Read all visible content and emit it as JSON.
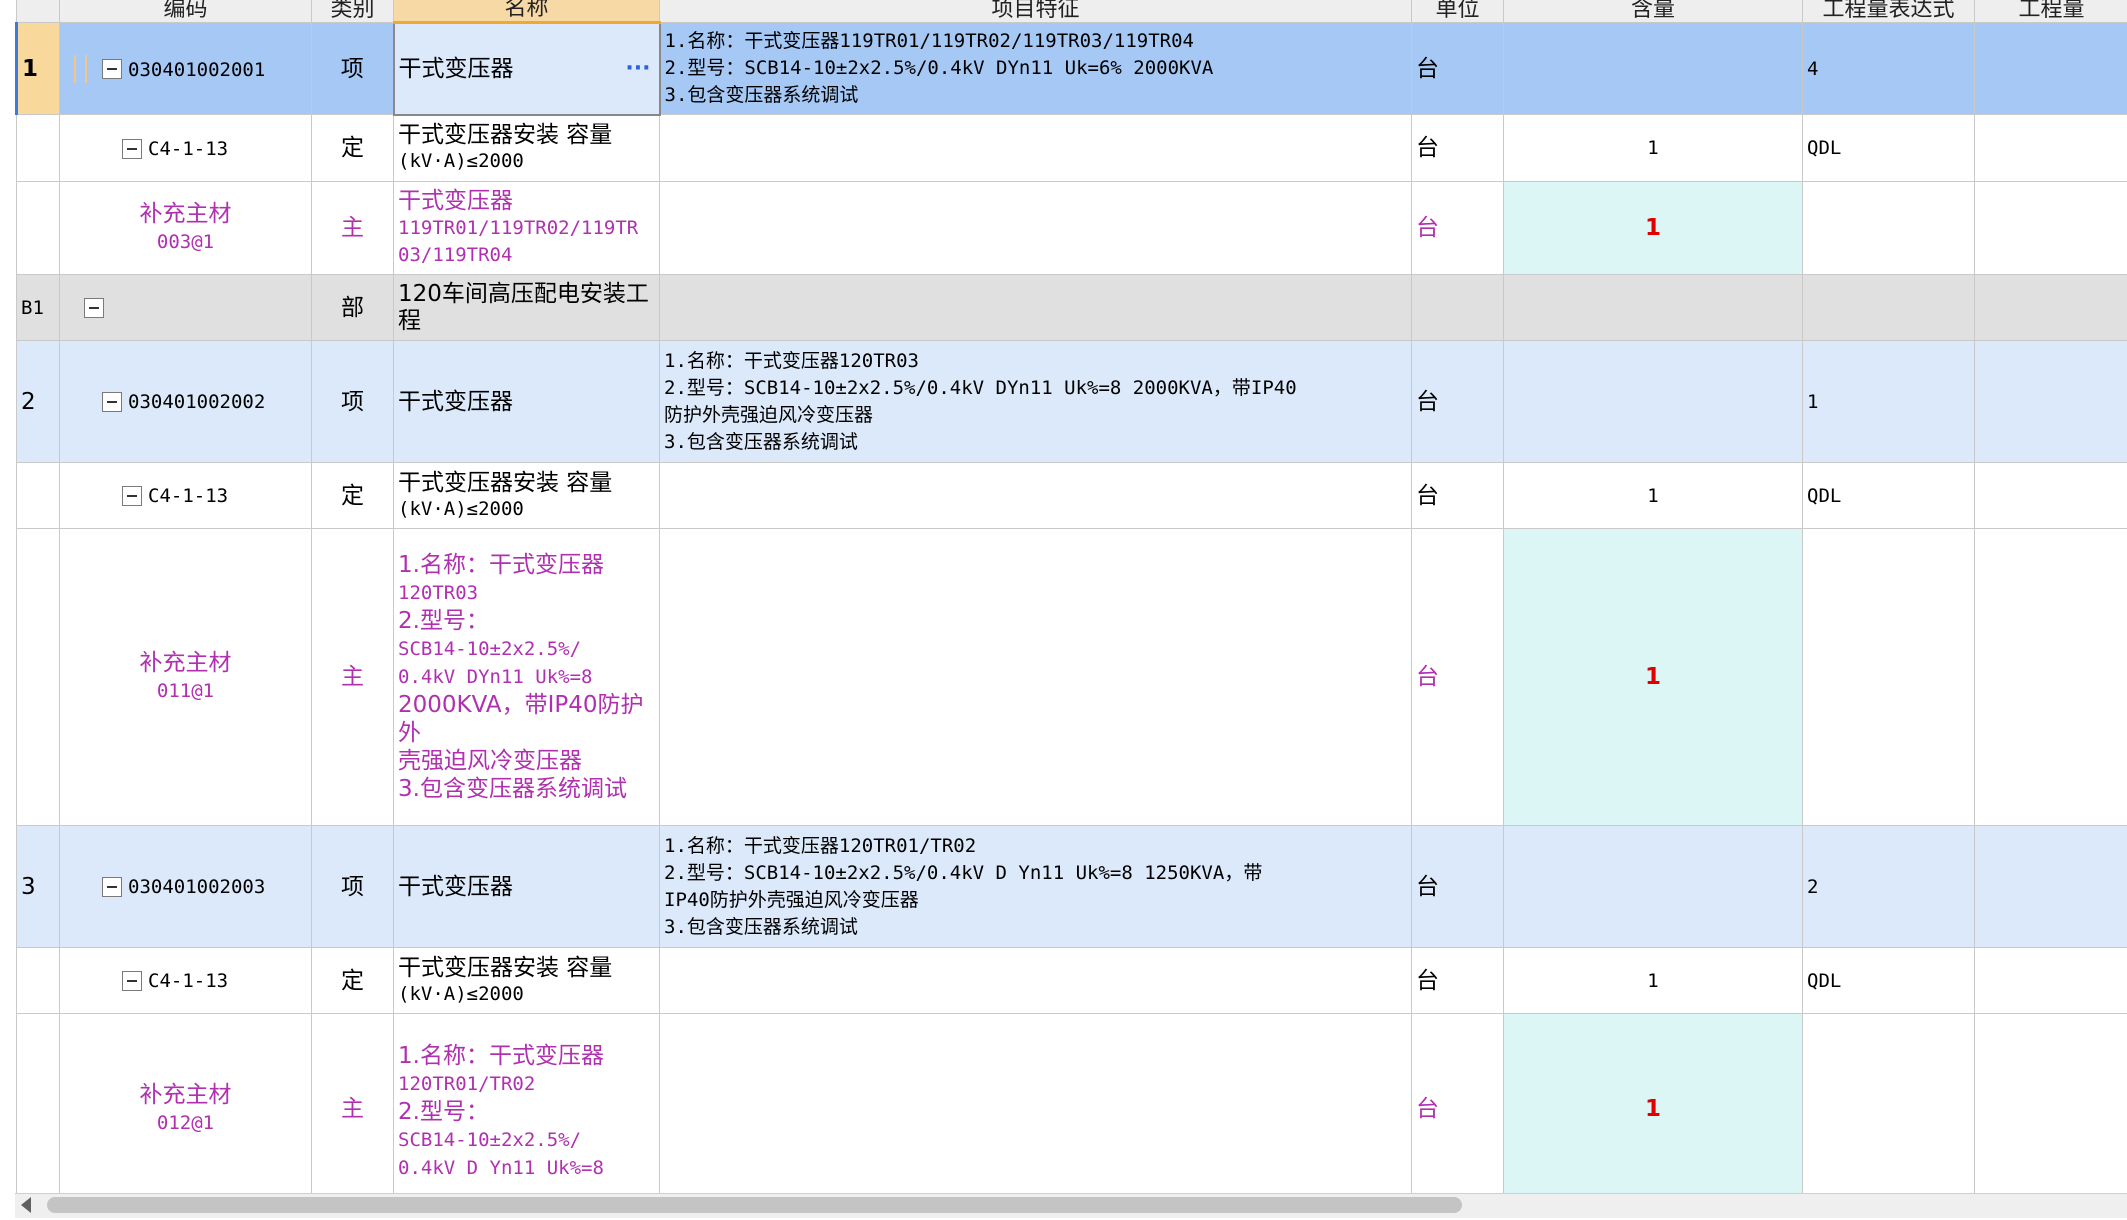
{
  "headers": [
    "编码",
    "类别",
    "名称",
    "项目特征",
    "单位",
    "含量",
    "工程量表达式",
    "工程量"
  ],
  "rows": [
    {
      "seq": "1",
      "code": "030401002001",
      "type": "项",
      "name": "干式变压器",
      "feat": [
        "1.名称：干式变压器119TR01/119TR02/119TR03/119TR04",
        "2.型号：SCB14-10±2x2.5%/0.4kV  DYn11  Uk=6%   2000KVA",
        "3.包含变压器系统调试"
      ],
      "unit": "台",
      "qty": "",
      "expr": "4",
      "amount": ""
    },
    {
      "seq": "",
      "code": "C4-1-13",
      "type": "定",
      "name": [
        "干式变压器安装 容量",
        "(kV·A)≤2000"
      ],
      "feat": [],
      "unit": "台",
      "qty": "1",
      "expr": "QDL",
      "amount": ""
    },
    {
      "seq": "",
      "code": [
        "补充主材",
        "003@1"
      ],
      "type": "主",
      "name": [
        "干式变压器",
        "119TR01/119TR02/119TR",
        "03/119TR04"
      ],
      "feat": [],
      "unit": "台",
      "qty": "1",
      "expr": "",
      "amount": ""
    },
    {
      "seq": "B1",
      "code": "",
      "type": "部",
      "name": [
        "120车间高压配电安装工",
        "程"
      ],
      "feat": [],
      "unit": "",
      "qty": "",
      "expr": "",
      "amount": ""
    },
    {
      "seq": "2",
      "code": "030401002002",
      "type": "项",
      "name": "干式变压器",
      "feat": [
        "1.名称：干式变压器120TR03",
        "2.型号：SCB14-10±2x2.5%/0.4kV  DYn11  Uk%=8   2000KVA，带IP40",
        "防护外壳强迫风冷变压器",
        "3.包含变压器系统调试"
      ],
      "unit": "台",
      "qty": "",
      "expr": "1",
      "amount": ""
    },
    {
      "seq": "",
      "code": "C4-1-13",
      "type": "定",
      "name": [
        "干式变压器安装 容量",
        "(kV·A)≤2000"
      ],
      "feat": [],
      "unit": "台",
      "qty": "1",
      "expr": "QDL",
      "amount": ""
    },
    {
      "seq": "",
      "code": [
        "补充主材",
        "011@1"
      ],
      "type": "主",
      "name": [
        "1.名称：干式变压器",
        "120TR03",
        "2.型号：",
        "SCB14-10±2x2.5%/",
        "0.4kV  DYn11  Uk%=8",
        "2000KVA，带IP40防护外",
        "壳强迫风冷变压器",
        "3.包含变压器系统调试"
      ],
      "feat": [],
      "unit": "台",
      "qty": "1",
      "expr": "",
      "amount": ""
    },
    {
      "seq": "3",
      "code": "030401002003",
      "type": "项",
      "name": "干式变压器",
      "feat": [
        "1.名称：干式变压器120TR01/TR02",
        "2.型号：SCB14-10±2x2.5%/0.4kV  D Yn11  Uk%=8   1250KVA，带",
        "IP40防护外壳强迫风冷变压器",
        "3.包含变压器系统调试"
      ],
      "unit": "台",
      "qty": "",
      "expr": "2",
      "amount": ""
    },
    {
      "seq": "",
      "code": "C4-1-13",
      "type": "定",
      "name": [
        "干式变压器安装 容量",
        "(kV·A)≤2000"
      ],
      "feat": [],
      "unit": "台",
      "qty": "1",
      "expr": "QDL",
      "amount": ""
    },
    {
      "seq": "",
      "code": [
        "补充主材",
        "012@1"
      ],
      "type": "主",
      "name": [
        "1.名称：干式变压器",
        "120TR01/TR02",
        "2.型号：",
        "SCB14-10±2x2.5%/",
        "0.4kV  D Yn11  Uk%=8"
      ],
      "feat": [],
      "unit": "台",
      "qty": "1",
      "expr": "",
      "amount": ""
    }
  ],
  "more_button": "···"
}
